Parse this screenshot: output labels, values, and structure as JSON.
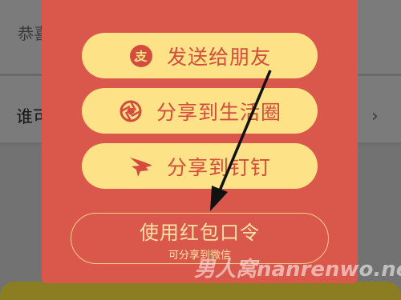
{
  "background": {
    "row1_text": "恭喜",
    "row2_text": "谁可",
    "chevron": "›"
  },
  "share_panel": {
    "send_to_friend": "发送给朋友",
    "share_to_moments": "分享到生活圈",
    "share_to_dingtalk": "分享到钉钉",
    "use_password": "使用红包口令",
    "use_password_sub": "可分享到微信"
  },
  "watermark": "男人窝nanrenwo.net",
  "colors": {
    "panel": "#d9584b",
    "pill": "#fde287",
    "pill_text": "#d34c3d",
    "outline_text": "#fbe3a7"
  }
}
